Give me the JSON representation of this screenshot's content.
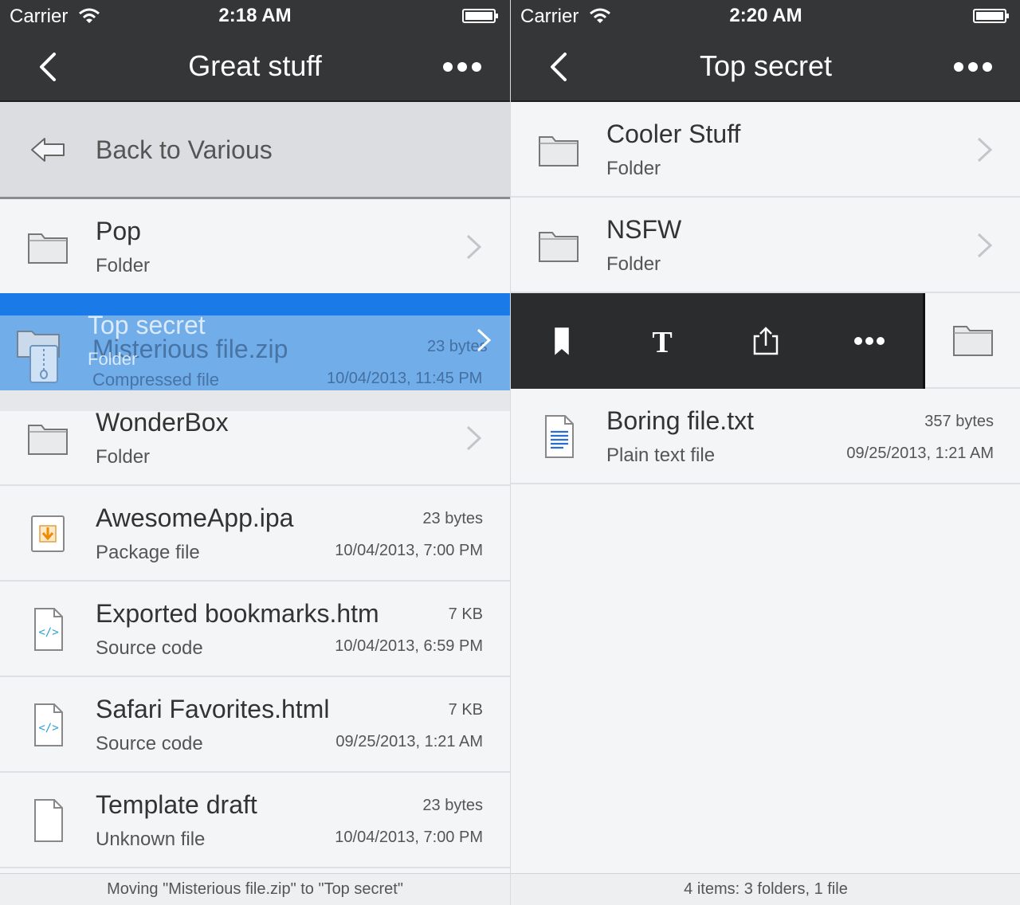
{
  "left": {
    "status": {
      "carrier": "Carrier",
      "time": "2:18 AM"
    },
    "nav": {
      "title": "Great stuff"
    },
    "back_row": {
      "label": "Back to Various"
    },
    "rows": [
      {
        "title": "Pop",
        "subtitle": "Folder",
        "icon": "folder-icon"
      },
      {
        "title": "WonderBox",
        "subtitle": "Folder",
        "icon": "folder-icon"
      },
      {
        "title": "AwesomeApp.ipa",
        "subtitle": "Package file",
        "size": "23 bytes",
        "date": "10/04/2013, 7:00 PM",
        "icon": "package-icon"
      },
      {
        "title": "Exported bookmarks.htm",
        "subtitle": "Source code",
        "size": "7 KB",
        "date": "10/04/2013, 6:59 PM",
        "icon": "source-code-icon"
      },
      {
        "title": "Safari Favorites.html",
        "subtitle": "Source code",
        "size": "7 KB",
        "date": "09/25/2013, 1:21 AM",
        "icon": "source-code-icon"
      },
      {
        "title": "Template draft",
        "subtitle": "Unknown file",
        "size": "23 bytes",
        "date": "10/04/2013, 7:00 PM",
        "icon": "unknown-file-icon"
      }
    ],
    "drag": {
      "target_title": "Top secret",
      "target_subtitle": "Folder",
      "item_title": "Misterious file.zip",
      "item_subtitle": "Compressed file",
      "item_size": "23 bytes",
      "item_date": "10/04/2013, 11:45 PM"
    },
    "footer": "Moving \"Misterious file.zip\" to \"Top secret\""
  },
  "right": {
    "status": {
      "carrier": "Carrier",
      "time": "2:20 AM"
    },
    "nav": {
      "title": "Top secret"
    },
    "rows": [
      {
        "title": "Cooler Stuff",
        "subtitle": "Folder",
        "icon": "folder-icon"
      },
      {
        "title": "NSFW",
        "subtitle": "Folder",
        "icon": "folder-icon"
      },
      {
        "title": "Boring file.txt",
        "subtitle": "Plain text file",
        "size": "357 bytes",
        "date": "09/25/2013, 1:21 AM",
        "icon": "text-file-icon"
      }
    ],
    "actions": [
      "bookmark-icon",
      "rename-text-icon",
      "share-icon",
      "more-icon"
    ],
    "footer": "4 items: 3 folders, 1 file"
  },
  "colors": {
    "bar": "#353638",
    "drag_blue": "#1a7be8",
    "text_file_blue": "#2a6fd0",
    "package_orange": "#f08a00"
  }
}
